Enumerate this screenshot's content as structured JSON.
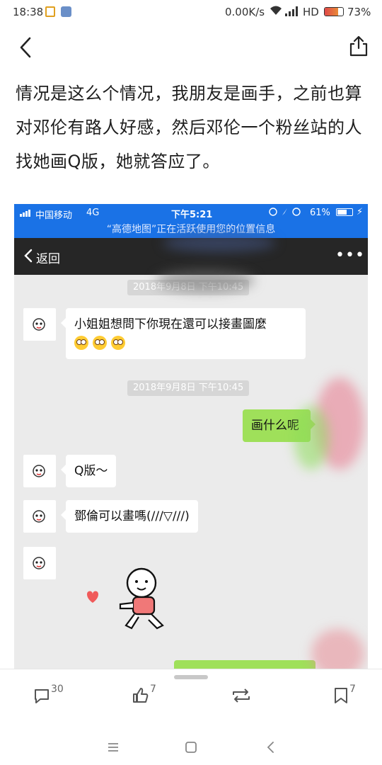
{
  "status_bar": {
    "time": "18:38",
    "speed": "0.00K/s",
    "network": "HD",
    "battery": "73%",
    "battery_level": 0.73,
    "icons": [
      "notification-icon",
      "app-icon",
      "wifi-icon",
      "signal-icon",
      "battery-icon"
    ]
  },
  "top_bar": {
    "back_icon": "chevron-left-icon",
    "share_icon": "share-icon"
  },
  "post": {
    "text": "情况是这么个情况，我朋友是画手，之前也算对邓伦有路人好感，然后邓伦一个粉丝站的人找她画Q版，她就答应了。"
  },
  "screenshot": {
    "status": {
      "carrier": "中国移动",
      "network": "4G",
      "time": "下午5:21",
      "battery": "61%",
      "location_notice": "“高德地图”正在活跃使用您的位置信息"
    },
    "header": {
      "back_label": "返回",
      "more_icon": "more-dots-icon"
    },
    "messages": [
      {
        "type": "timestamp",
        "text": "2018年9月8日 下午10:45"
      },
      {
        "type": "incoming",
        "text": "小姐姐想問下你現在還可以接畫圖麼",
        "emoji": [
          "flushed-face",
          "flushed-face",
          "flushed-face"
        ]
      },
      {
        "type": "timestamp",
        "text": "2018年9月8日 下午10:45"
      },
      {
        "type": "outgoing",
        "text": "画什么呢"
      },
      {
        "type": "incoming",
        "text": "Q版～"
      },
      {
        "type": "incoming",
        "text": "鄧倫可以畫嗎(///▽///)"
      },
      {
        "type": "incoming-sticker",
        "sticker": "kneeling-heart-sticker"
      }
    ]
  },
  "actions": {
    "comments": {
      "icon": "comment-icon",
      "count": "30"
    },
    "likes": {
      "icon": "thumbs-up-icon",
      "count": "7"
    },
    "repost": {
      "icon": "repost-icon"
    },
    "favorites": {
      "icon": "bookmark-icon",
      "count": "7"
    }
  },
  "nav": {
    "menu_icon": "menu-icon",
    "home_icon": "home-icon",
    "back_icon": "back-icon"
  },
  "colors": {
    "screenshot_status_bar": "#1a72e6",
    "chat_header": "#262626",
    "outgoing_bubble": "#9fe05a",
    "chat_background": "#ebebeb"
  }
}
